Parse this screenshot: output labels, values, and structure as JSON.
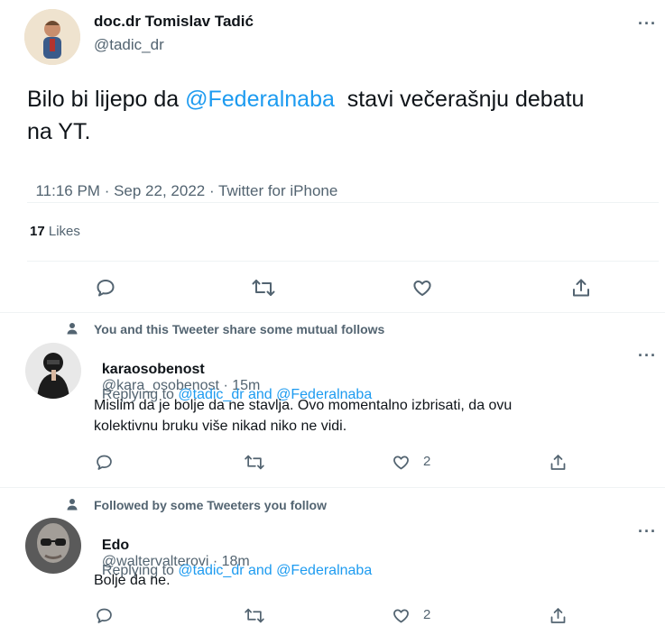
{
  "main_tweet": {
    "display_name": "doc.dr Tomislav Tadić",
    "handle": "@tadic_dr",
    "text_before": "Bilo bi lijepo da ",
    "mention": "@Federalnaba",
    "text_after_line1": "  stavi večerašnju debatu",
    "text_line2": "na YT.",
    "time": "11:16 PM",
    "sep1": " · ",
    "date": "Sep 22, 2022",
    "sep2": " · ",
    "source": "Twitter for iPhone",
    "likes_count": "17",
    "likes_label": "Likes"
  },
  "more_glyph": "···",
  "replies": [
    {
      "context": "You and this Tweeter share some mutual follows",
      "display_name": "karaosobenost",
      "handle": "@kara_osobenost",
      "sep": " · ",
      "age": "15m",
      "replying_prefix": "Replying to ",
      "replying_targets": "@tadic_dr and @Federalnaba",
      "body_line1": "Mislim da je bolje da ne stavlja. Ovo momentalno izbrisati, da ovu",
      "body_line2": "kolektivnu bruku više nikad niko ne vidi.",
      "like_count": "2"
    },
    {
      "context": "Followed by some Tweeters you follow",
      "display_name": "Edo",
      "handle": "@waltervalterovi",
      "sep": " · ",
      "age": "18m",
      "replying_prefix": "Replying to ",
      "replying_targets": "@tadic_dr and @Federalnaba",
      "body_line1": "Bolje da ne.",
      "like_count": "2"
    }
  ],
  "icons": [
    "reply-icon",
    "retweet-icon",
    "like-icon",
    "share-icon",
    "person-icon",
    "more-icon"
  ],
  "colors": {
    "link": "#1d9bf0",
    "secondary": "#536471",
    "text": "#0f1419",
    "divider": "#eff3f4"
  }
}
